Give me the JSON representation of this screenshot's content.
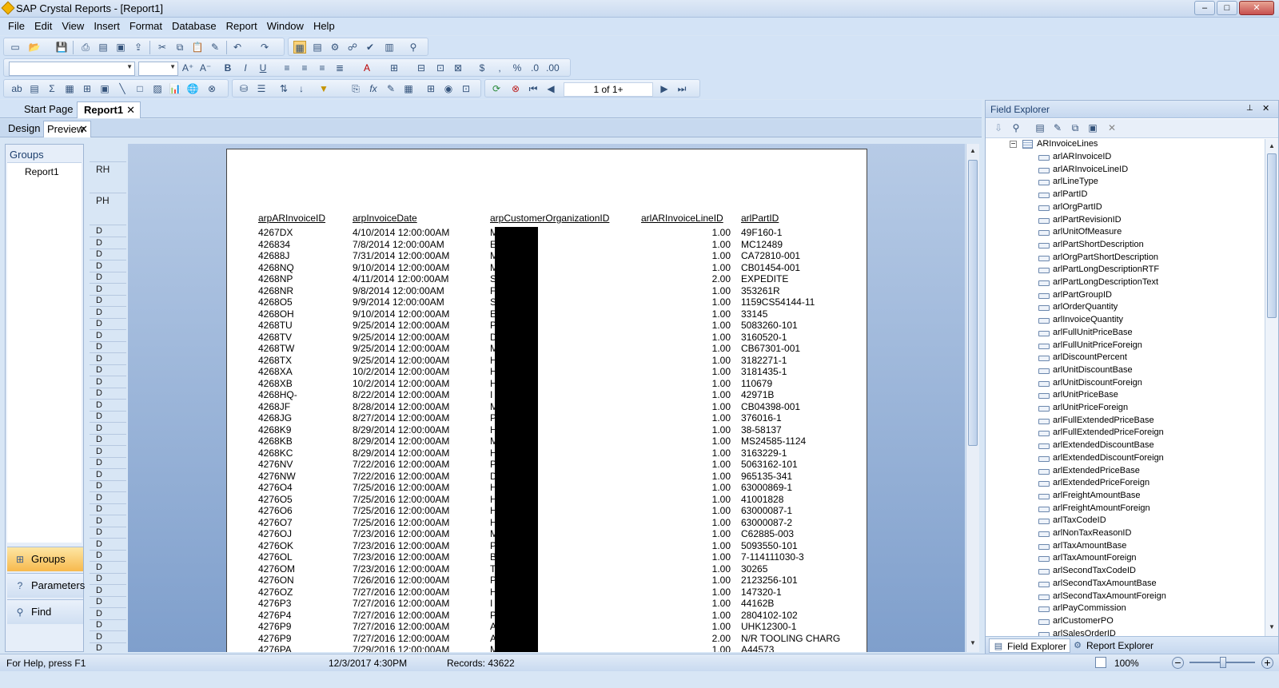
{
  "window": {
    "title": "SAP Crystal Reports - [Report1]",
    "min": "–",
    "max": "□",
    "close": "✕"
  },
  "menu": [
    "File",
    "Edit",
    "View",
    "Insert",
    "Format",
    "Database",
    "Report",
    "Window",
    "Help"
  ],
  "toolbar": {
    "page_nav": "1 of 1+"
  },
  "doc_tabs": {
    "start": "Start Page",
    "report": "Report1",
    "close": "✕"
  },
  "view_tabs": {
    "design": "Design",
    "preview": "Preview",
    "close": "✕"
  },
  "left_panel": {
    "title": "Groups",
    "node": "Report1",
    "buttons": {
      "groups": "Groups",
      "parameters": "Parameters",
      "find": "Find"
    }
  },
  "sections": {
    "rh": "RH",
    "ph": "PH",
    "d": "D"
  },
  "report": {
    "headers": [
      "arpARInvoiceID",
      "arpInvoiceDate",
      "arpCustomerOrganizationID",
      "arlARInvoiceLineID",
      "arlPartID"
    ],
    "rows": [
      [
        "4267DX",
        "4/10/2014  12:00:00AM",
        "M",
        "1.00",
        "49F160-1"
      ],
      [
        "426834",
        "7/8/2014  12:00:00AM",
        "E",
        "1.00",
        "MC12489"
      ],
      [
        "42688J",
        "7/31/2014  12:00:00AM",
        "M",
        "1.00",
        "CA72810-001"
      ],
      [
        "4268NQ",
        "9/10/2014  12:00:00AM",
        "M",
        "1.00",
        "CB01454-001"
      ],
      [
        "4268NP",
        "4/11/2014  12:00:00AM",
        "S",
        "2.00",
        "EXPEDITE"
      ],
      [
        "4268NR",
        "9/8/2014  12:00:00AM",
        "F",
        "1.00",
        "353261R"
      ],
      [
        "4268O5",
        "9/9/2014  12:00:00AM",
        "S",
        "1.00",
        "1159CS54144-11"
      ],
      [
        "4268OH",
        "9/10/2014  12:00:00AM",
        "E",
        "1.00",
        "33145"
      ],
      [
        "4268TU",
        "9/25/2014  12:00:00AM",
        "P",
        "1.00",
        "5083260-101"
      ],
      [
        "4268TV",
        "9/25/2014  12:00:00AM",
        "D",
        "1.00",
        "3160520-1"
      ],
      [
        "4268TW",
        "9/25/2014  12:00:00AM",
        "M",
        "1.00",
        "CB67301-001"
      ],
      [
        "4268TX",
        "9/25/2014  12:00:00AM",
        "H",
        "1.00",
        "3182271-1"
      ],
      [
        "4268XA",
        "10/2/2014  12:00:00AM",
        "H",
        "1.00",
        "3181435-1"
      ],
      [
        "4268XB",
        "10/2/2014  12:00:00AM",
        "H",
        "1.00",
        "110679"
      ],
      [
        "4268HQ-",
        "8/22/2014  12:00:00AM",
        "I",
        "1.00",
        "42971B"
      ],
      [
        "4268JF",
        "8/28/2014  12:00:00AM",
        "M",
        "1.00",
        "CB04398-001"
      ],
      [
        "4268JG",
        "8/27/2014  12:00:00AM",
        "P",
        "1.00",
        "376016-1"
      ],
      [
        "4268K9",
        "8/29/2014  12:00:00AM",
        "H",
        "1.00",
        "38-58137"
      ],
      [
        "4268KB",
        "8/29/2014  12:00:00AM",
        "M",
        "1.00",
        "MS24585-1124"
      ],
      [
        "4268KC",
        "8/29/2014  12:00:00AM",
        "H",
        "1.00",
        "3163229-1"
      ],
      [
        "4276NV",
        "7/22/2016  12:00:00AM",
        "P",
        "1.00",
        "5063162-101"
      ],
      [
        "4276NW",
        "7/22/2016  12:00:00AM",
        "D",
        "1.00",
        "965135-341"
      ],
      [
        "4276O4",
        "7/25/2016  12:00:00AM",
        "H",
        "1.00",
        "63000869-1"
      ],
      [
        "4276O5",
        "7/25/2016  12:00:00AM",
        "H",
        "1.00",
        "41001828"
      ],
      [
        "4276O6",
        "7/25/2016  12:00:00AM",
        "H",
        "1.00",
        "63000087-1"
      ],
      [
        "4276O7",
        "7/25/2016  12:00:00AM",
        "H",
        "1.00",
        "63000087-2"
      ],
      [
        "4276OJ",
        "7/23/2016  12:00:00AM",
        "M",
        "1.00",
        "C62885-003"
      ],
      [
        "4276OK",
        "7/23/2016  12:00:00AM",
        "P",
        "1.00",
        "5093550-101"
      ],
      [
        "4276OL",
        "7/23/2016  12:00:00AM",
        "B",
        "1.00",
        "7-114111030-3"
      ],
      [
        "4276OM",
        "7/23/2016  12:00:00AM",
        "T",
        "1.00",
        "30265"
      ],
      [
        "4276ON",
        "7/26/2016  12:00:00AM",
        "P",
        "1.00",
        "2123256-101"
      ],
      [
        "4276OZ",
        "7/27/2016  12:00:00AM",
        "H",
        "1.00",
        "147320-1"
      ],
      [
        "4276P3",
        "7/27/2016  12:00:00AM",
        "I",
        "1.00",
        "44162B"
      ],
      [
        "4276P4",
        "7/27/2016  12:00:00AM",
        "P",
        "1.00",
        "2804102-102"
      ],
      [
        "4276P9",
        "7/27/2016  12:00:00AM",
        "A",
        "1.00",
        "UHK12300-1"
      ],
      [
        "4276P9",
        "7/27/2016  12:00:00AM",
        "A",
        "2.00",
        "N/R TOOLING CHARG"
      ],
      [
        "4276PA",
        "7/29/2016  12:00:00AM",
        "M",
        "1.00",
        "A44573"
      ]
    ]
  },
  "status": {
    "help": "For Help, press F1",
    "datetime": "12/3/2017  4:30PM",
    "records": "Records:  43622",
    "zoom": "100%"
  },
  "field_explorer": {
    "title": "Field Explorer",
    "table": "ARInvoiceLines",
    "fields": [
      "arlARInvoiceID",
      "arlARInvoiceLineID",
      "arlLineType",
      "arlPartID",
      "arlOrgPartID",
      "arlPartRevisionID",
      "arlUnitOfMeasure",
      "arlPartShortDescription",
      "arlOrgPartShortDescription",
      "arlPartLongDescriptionRTF",
      "arlPartLongDescriptionText",
      "arlPartGroupID",
      "arlOrderQuantity",
      "arlInvoiceQuantity",
      "arlFullUnitPriceBase",
      "arlFullUnitPriceForeign",
      "arlDiscountPercent",
      "arlUnitDiscountBase",
      "arlUnitDiscountForeign",
      "arlUnitPriceBase",
      "arlUnitPriceForeign",
      "arlFullExtendedPriceBase",
      "arlFullExtendedPriceForeign",
      "arlExtendedDiscountBase",
      "arlExtendedDiscountForeign",
      "arlExtendedPriceBase",
      "arlExtendedPriceForeign",
      "arlFreightAmountBase",
      "arlFreightAmountForeign",
      "arlTaxCodeID",
      "arlNonTaxReasonID",
      "arlTaxAmountBase",
      "arlTaxAmountForeign",
      "arlSecondTaxCodeID",
      "arlSecondTaxAmountBase",
      "arlSecondTaxAmountForeign",
      "arlPayCommission",
      "arlCustomerPO",
      "arlSalesOrderID"
    ],
    "bottom_tabs": {
      "fe": "Field Explorer",
      "re": "Report Explorer"
    }
  }
}
